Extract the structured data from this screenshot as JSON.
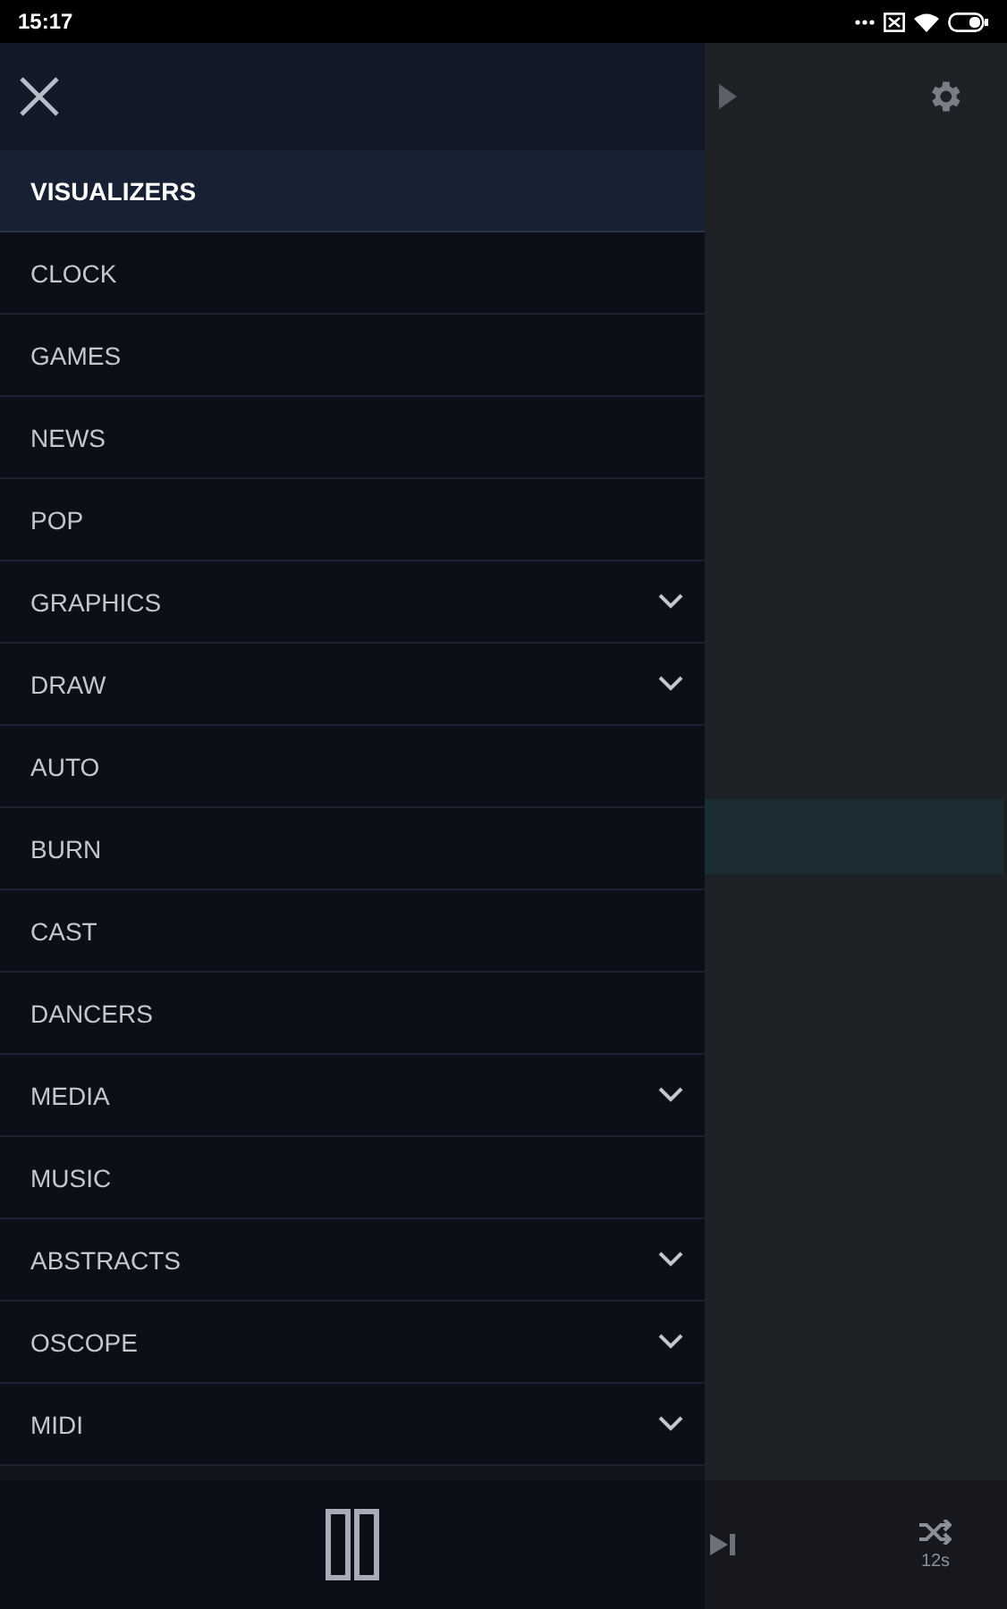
{
  "status_bar": {
    "time": "15:17"
  },
  "menu": [
    {
      "label": "VISUALIZERS",
      "selected": true,
      "kind": "item"
    },
    {
      "label": "CLOCK",
      "selected": false,
      "kind": "item"
    },
    {
      "label": "GAMES",
      "selected": false,
      "kind": "item"
    },
    {
      "label": "NEWS",
      "selected": false,
      "kind": "item"
    },
    {
      "label": "POP",
      "selected": false,
      "kind": "item"
    },
    {
      "label": "GRAPHICS",
      "selected": false,
      "kind": "group"
    },
    {
      "label": "DRAW",
      "selected": false,
      "kind": "group"
    },
    {
      "label": "AUTO",
      "selected": false,
      "kind": "item"
    },
    {
      "label": "BURN",
      "selected": false,
      "kind": "item"
    },
    {
      "label": "CAST",
      "selected": false,
      "kind": "item"
    },
    {
      "label": "DANCERS",
      "selected": false,
      "kind": "item"
    },
    {
      "label": "MEDIA",
      "selected": false,
      "kind": "group"
    },
    {
      "label": "MUSIC",
      "selected": false,
      "kind": "item"
    },
    {
      "label": "ABSTRACTS",
      "selected": false,
      "kind": "group"
    },
    {
      "label": "OSCOPE",
      "selected": false,
      "kind": "group"
    },
    {
      "label": "MIDI",
      "selected": false,
      "kind": "group"
    }
  ],
  "player": {
    "shuffle_interval": "12s"
  }
}
